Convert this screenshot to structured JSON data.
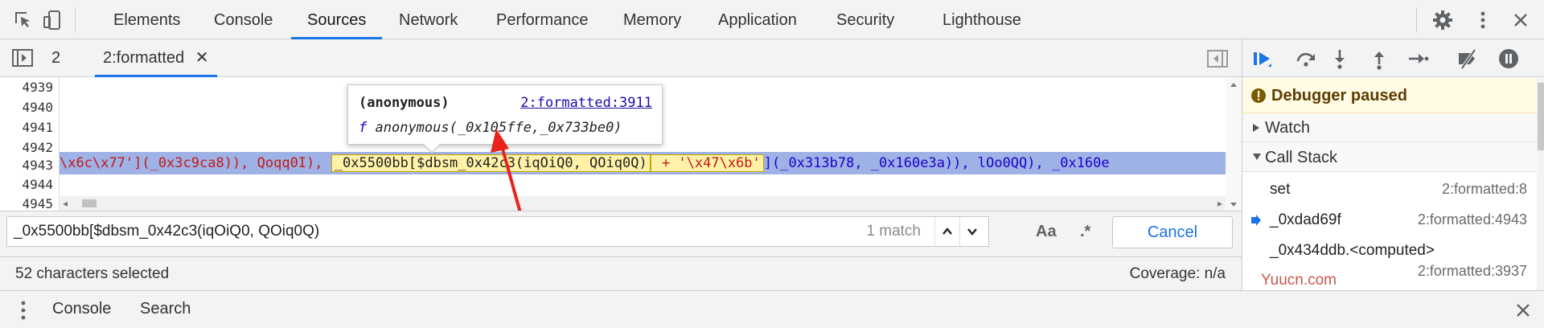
{
  "devtools": {
    "tabs": [
      "Elements",
      "Console",
      "Sources",
      "Network",
      "Performance",
      "Memory",
      "Application",
      "Security",
      "Lighthouse"
    ],
    "active_tab": "Sources",
    "icons": [
      "inspect-element-icon",
      "device-toolbar-icon",
      "settings-gear-icon",
      "more-menu-icon",
      "close-icon"
    ]
  },
  "editor": {
    "tabs": [
      {
        "label": "2",
        "active": false
      },
      {
        "label": "2:formatted",
        "active": true
      }
    ],
    "line_numbers": [
      "4939",
      "4940",
      "4941",
      "4942",
      "4943",
      "4944",
      "4945"
    ],
    "code_line_segments": {
      "s1": "\\x6c\\x77'](_0x3c9ca8)), Qoqq0I), ",
      "s2": "_0x5500bb[$dbsm_0x42c3(iqOiQ0, QOiq0Q)",
      "s3": " + '\\x47\\x6b'",
      "s4": "](_0x313b78, _0x160e3a)), lOo0QQ), _0x160e"
    }
  },
  "tooltip": {
    "name": "(anonymous)",
    "link": "2:formatted:3911",
    "f": "f",
    "signature": "anonymous(_0x105ffe,_0x733be0)"
  },
  "search": {
    "value": "_0x5500bb[$dbsm_0x42c3(iqOiQ0, QOiq0Q)",
    "match_count": "1 match",
    "case_label": "Aa",
    "regex_label": ".*",
    "cancel_label": "Cancel"
  },
  "status": {
    "selection": "52 characters selected",
    "coverage": "Coverage: n/a"
  },
  "debugger": {
    "paused_label": "Debugger paused",
    "watch_label": "Watch",
    "callstack_label": "Call Stack",
    "frames": [
      {
        "fn": "set",
        "loc": "2:formatted:8",
        "current": false
      },
      {
        "fn": "_0xdad69f",
        "loc": "2:formatted:4943",
        "current": true
      },
      {
        "fn": "_0x434ddb.<computed>",
        "loc": "2:formatted:3937",
        "current": false
      }
    ],
    "watermark": "Yuucn.com"
  },
  "drawer": {
    "tabs": [
      "Console",
      "Search"
    ]
  }
}
